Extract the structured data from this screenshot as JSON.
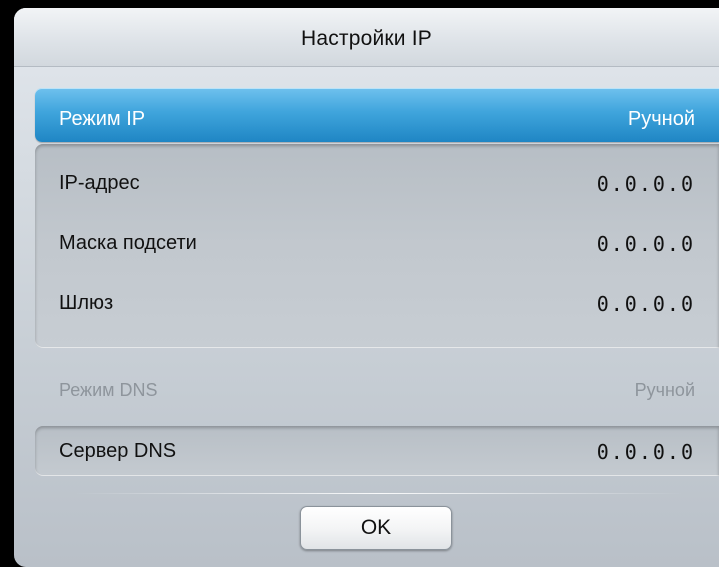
{
  "dialog": {
    "title": "Настройки IP"
  },
  "ip_mode": {
    "label": "Режим IP",
    "value": "Ручной"
  },
  "fields": [
    {
      "label": "IP-адрес",
      "value": "0.0.0.0"
    },
    {
      "label": "Маска подсети",
      "value": "0.0.0.0"
    },
    {
      "label": "Шлюз",
      "value": "0.0.0.0"
    }
  ],
  "dns_mode": {
    "label": "Режим DNS",
    "value": "Ручной"
  },
  "dns_server": {
    "label": "Сервер DNS",
    "value": "0.0.0.0"
  },
  "ok_button": {
    "label": "OK"
  },
  "colors": {
    "highlight": "#1f86c4",
    "disabled_text": "#8e959c",
    "panel": "#c6cdd4",
    "text": "#111111"
  }
}
